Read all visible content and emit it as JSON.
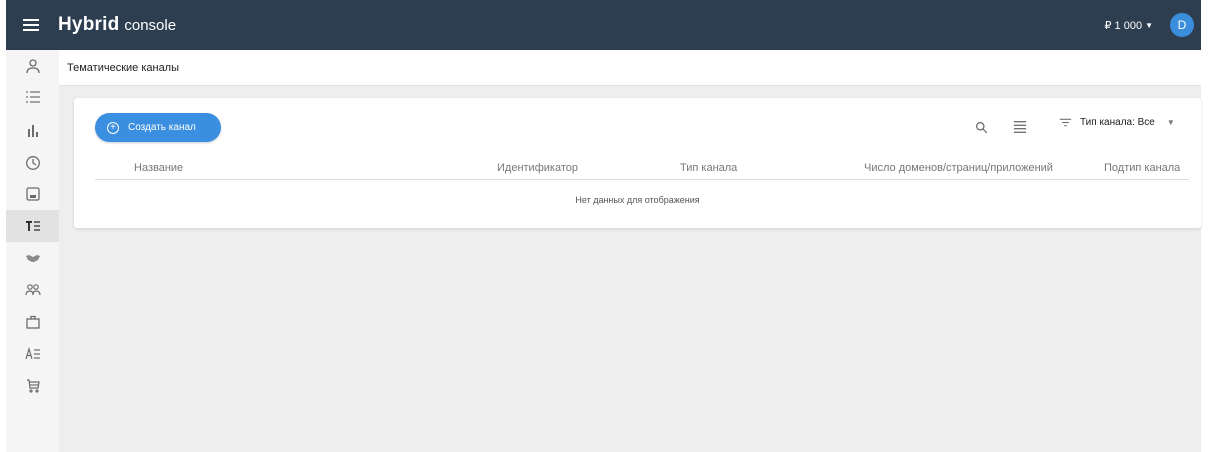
{
  "header": {
    "logo_main": "Hybrid",
    "logo_sub": "console",
    "balance": "₽ 1 000",
    "user_initial": "D"
  },
  "sidebar": {
    "items": [
      {
        "icon": "user-icon"
      },
      {
        "icon": "list-icon"
      },
      {
        "icon": "bar-chart-icon"
      },
      {
        "icon": "clock-icon"
      },
      {
        "icon": "image-icon"
      },
      {
        "icon": "text-list-icon",
        "active": true
      },
      {
        "icon": "handshake-icon"
      },
      {
        "icon": "users-icon"
      },
      {
        "icon": "briefcase-icon"
      },
      {
        "icon": "font-list-icon"
      },
      {
        "icon": "cart-icon"
      }
    ]
  },
  "page": {
    "title": "Тематические каналы"
  },
  "toolbar": {
    "create_label": "Создать канал",
    "filter_label": "Тип канала: Все"
  },
  "table": {
    "columns": [
      "Название",
      "Идентификатор",
      "Тип канала",
      "Число доменов/страниц/приложений",
      "Подтип канала"
    ],
    "empty_message": "Нет данных для отображения"
  },
  "colors": {
    "topbar": "#2c3e50",
    "accent": "#3b8fe0",
    "background": "#eeeeee"
  }
}
